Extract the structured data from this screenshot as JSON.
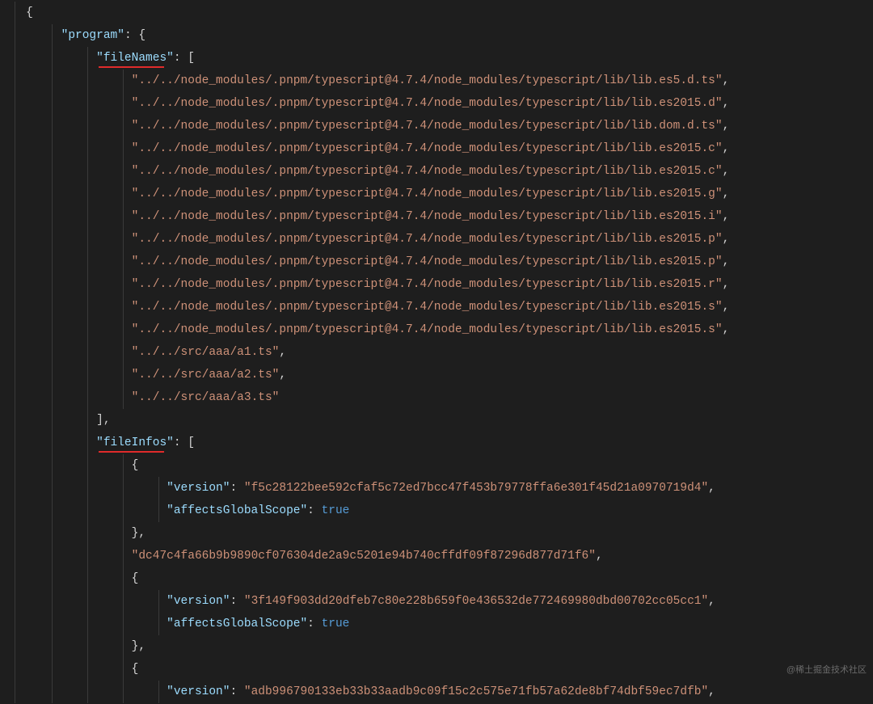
{
  "lines": [
    {
      "indent": 0,
      "t": "brace",
      "text": "{"
    },
    {
      "indent": 1,
      "t": "key",
      "key": "program",
      "after": ": {"
    },
    {
      "indent": 2,
      "t": "key",
      "key": "fileNames",
      "after": ": [",
      "ul": true
    },
    {
      "indent": 3,
      "t": "str",
      "text": "../../node_modules/.pnpm/typescript@4.7.4/node_modules/typescript/lib/lib.es5.d.ts",
      "comma": true
    },
    {
      "indent": 3,
      "t": "str",
      "text": "../../node_modules/.pnpm/typescript@4.7.4/node_modules/typescript/lib/lib.es2015.d",
      "comma": true
    },
    {
      "indent": 3,
      "t": "str",
      "text": "../../node_modules/.pnpm/typescript@4.7.4/node_modules/typescript/lib/lib.dom.d.ts",
      "comma": true
    },
    {
      "indent": 3,
      "t": "str",
      "text": "../../node_modules/.pnpm/typescript@4.7.4/node_modules/typescript/lib/lib.es2015.c",
      "comma": true
    },
    {
      "indent": 3,
      "t": "str",
      "text": "../../node_modules/.pnpm/typescript@4.7.4/node_modules/typescript/lib/lib.es2015.c",
      "comma": true
    },
    {
      "indent": 3,
      "t": "str",
      "text": "../../node_modules/.pnpm/typescript@4.7.4/node_modules/typescript/lib/lib.es2015.g",
      "comma": true
    },
    {
      "indent": 3,
      "t": "str",
      "text": "../../node_modules/.pnpm/typescript@4.7.4/node_modules/typescript/lib/lib.es2015.i",
      "comma": true
    },
    {
      "indent": 3,
      "t": "str",
      "text": "../../node_modules/.pnpm/typescript@4.7.4/node_modules/typescript/lib/lib.es2015.p",
      "comma": true
    },
    {
      "indent": 3,
      "t": "str",
      "text": "../../node_modules/.pnpm/typescript@4.7.4/node_modules/typescript/lib/lib.es2015.p",
      "comma": true
    },
    {
      "indent": 3,
      "t": "str",
      "text": "../../node_modules/.pnpm/typescript@4.7.4/node_modules/typescript/lib/lib.es2015.r",
      "comma": true
    },
    {
      "indent": 3,
      "t": "str",
      "text": "../../node_modules/.pnpm/typescript@4.7.4/node_modules/typescript/lib/lib.es2015.s",
      "comma": true
    },
    {
      "indent": 3,
      "t": "str",
      "text": "../../node_modules/.pnpm/typescript@4.7.4/node_modules/typescript/lib/lib.es2015.s",
      "comma": true
    },
    {
      "indent": 3,
      "t": "str",
      "text": "../../src/aaa/a1.ts",
      "comma": true
    },
    {
      "indent": 3,
      "t": "str",
      "text": "../../src/aaa/a2.ts",
      "comma": true
    },
    {
      "indent": 3,
      "t": "str",
      "text": "../../src/aaa/a3.ts",
      "comma": false
    },
    {
      "indent": 2,
      "t": "punct",
      "text": "],"
    },
    {
      "indent": 2,
      "t": "key",
      "key": "fileInfos",
      "after": ": [",
      "ul": true
    },
    {
      "indent": 3,
      "t": "punct",
      "text": "{"
    },
    {
      "indent": 4,
      "t": "kv",
      "key": "version",
      "vtype": "s",
      "val": "f5c28122bee592cfaf5c72ed7bcc47f453b79778ffa6e301f45d21a0970719d4",
      "comma": true
    },
    {
      "indent": 4,
      "t": "kv",
      "key": "affectsGlobalScope",
      "vtype": "b",
      "val": "true",
      "comma": false
    },
    {
      "indent": 3,
      "t": "punct",
      "text": "},"
    },
    {
      "indent": 3,
      "t": "str",
      "text": "dc47c4fa66b9b9890cf076304de2a9c5201e94b740cffdf09f87296d877d71f6",
      "comma": true
    },
    {
      "indent": 3,
      "t": "punct",
      "text": "{"
    },
    {
      "indent": 4,
      "t": "kv",
      "key": "version",
      "vtype": "s",
      "val": "3f149f903dd20dfeb7c80e228b659f0e436532de772469980dbd00702cc05cc1",
      "comma": true
    },
    {
      "indent": 4,
      "t": "kv",
      "key": "affectsGlobalScope",
      "vtype": "b",
      "val": "true",
      "comma": false
    },
    {
      "indent": 3,
      "t": "punct",
      "text": "},"
    },
    {
      "indent": 3,
      "t": "punct",
      "text": "{"
    },
    {
      "indent": 4,
      "t": "kv",
      "key": "version",
      "vtype": "s",
      "val": "adb996790133eb33b33aadb9c09f15c2c575e71fb57a62de8bf74dbf59ec7dfb",
      "comma": true
    }
  ],
  "watermark": "@稀土掘金技术社区"
}
